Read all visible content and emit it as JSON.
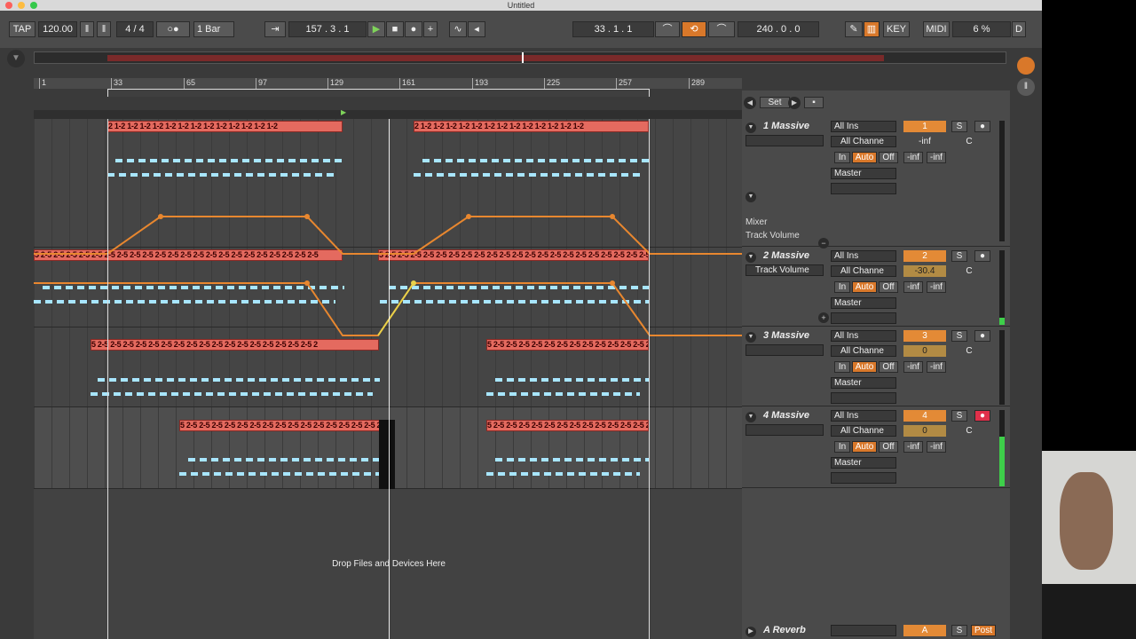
{
  "window": {
    "title": "Untitled"
  },
  "control_bar": {
    "tap": "TAP",
    "tempo": "120.00",
    "time_signature": "4 / 4",
    "metronome": "○●",
    "quantize": "1 Bar",
    "arrangement_position": "157 .   3 .   1",
    "loop_start": "33 .   1 .   1",
    "loop_length": "240 .   0 .   0",
    "key": "KEY",
    "midi": "MIDI",
    "cpu": "6 %",
    "d": "D"
  },
  "ruler": {
    "bars": [
      "1",
      "33",
      "65",
      "97",
      "129",
      "161",
      "193",
      "225",
      "257",
      "289"
    ]
  },
  "clip_text": {
    "t1": "2 1-2 1-2 1-2 1-2 1-2 1-2 1-2 1-2 1-2 1-2 1-2 1-2 1-2",
    "t2": "5 2-5 2-5 2-5 2-5 2-5 2-5 2-5 2-5 2-5 2-5 2-5 2-5 2-5 2-5 2-5 2-5 2-5 2-5 2-5 2-5 2-5 2-5",
    "t3": "5 2-5 2-5 2-5 2-5 2-5 2-5 2-5 2-5 2-5 2-5 2-5 2-5 2-5 2-5 2-5 2-5 2-5 2"
  },
  "arrangement": {
    "drop_hint": "Drop Files and Devices Here"
  },
  "mixer": {
    "set": "Set",
    "tracks": [
      {
        "name": "1 Massive",
        "input": "All Ins",
        "channel": "All Channe",
        "in": "In",
        "auto": "Auto",
        "off": "Off",
        "output": "Master",
        "number": "1",
        "solo": "S",
        "volume": "-inf",
        "pan": "C",
        "send_a": "-inf",
        "send_b": "-inf",
        "automation_device": "Mixer",
        "automation_param": "Track Volume"
      },
      {
        "name": "2 Massive",
        "input": "All Ins",
        "channel": "All Channe",
        "in": "In",
        "auto": "Auto",
        "off": "Off",
        "output": "Master",
        "number": "2",
        "solo": "S",
        "volume": "-30.4",
        "pan": "C",
        "send_a": "-inf",
        "send_b": "-inf",
        "automation_param": "Track Volume"
      },
      {
        "name": "3 Massive",
        "input": "All Ins",
        "channel": "All Channe",
        "in": "In",
        "auto": "Auto",
        "off": "Off",
        "output": "Master",
        "number": "3",
        "solo": "S",
        "volume": "0",
        "pan": "C",
        "send_a": "-inf",
        "send_b": "-inf"
      },
      {
        "name": "4 Massive",
        "input": "All Ins",
        "channel": "All Channe",
        "in": "In",
        "auto": "Auto",
        "off": "Off",
        "output": "Master",
        "number": "4",
        "solo": "S",
        "volume": "0",
        "pan": "C",
        "send_a": "-inf",
        "send_b": "-inf"
      }
    ],
    "return": {
      "name": "A Reverb",
      "letter": "A",
      "solo": "S",
      "post": "Post"
    }
  },
  "colors": {
    "clip": "#e46a5f",
    "accent": "#d9782a",
    "notes": "#a8e6ff",
    "automation": "#e8872f"
  }
}
